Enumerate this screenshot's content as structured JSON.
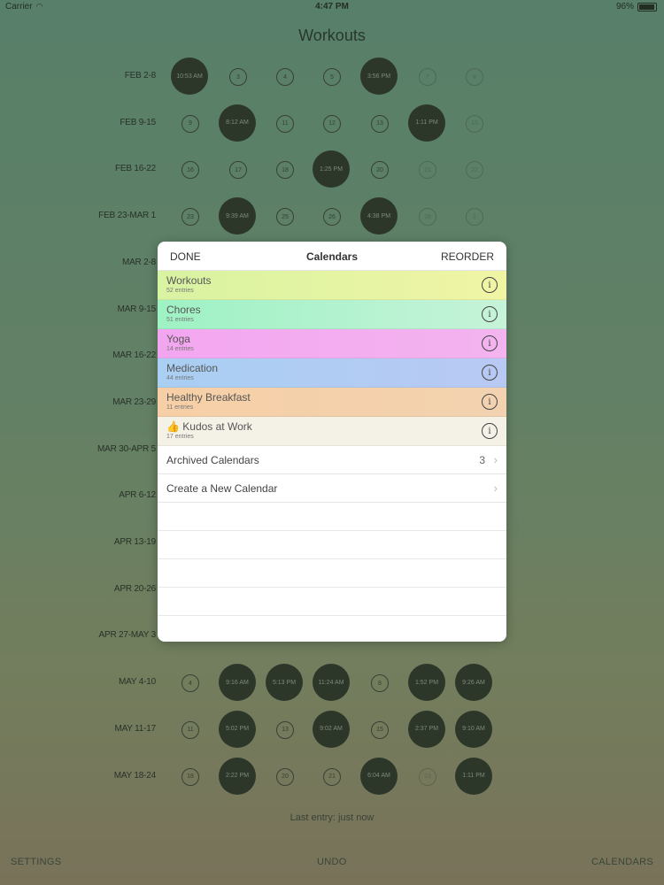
{
  "status": {
    "carrier": "Carrier",
    "time": "4:47 PM",
    "battery": "96%"
  },
  "title": "Workouts",
  "weeks": [
    {
      "label": "FEB 2-8",
      "cells": [
        {
          "t": "10:53 AM",
          "d": 1
        },
        {
          "t": "3",
          "d": 0
        },
        {
          "t": "4",
          "d": 0
        },
        {
          "t": "5",
          "d": 0
        },
        {
          "t": "3:56 PM",
          "d": 1
        },
        {
          "t": "7",
          "d": 0,
          "f": 1
        },
        {
          "t": "8",
          "d": 0,
          "f": 1
        }
      ]
    },
    {
      "label": "FEB 9-15",
      "cells": [
        {
          "t": "9",
          "d": 0
        },
        {
          "t": "8:12 AM",
          "d": 1
        },
        {
          "t": "11",
          "d": 0
        },
        {
          "t": "12",
          "d": 0
        },
        {
          "t": "13",
          "d": 0
        },
        {
          "t": "1:11 PM",
          "d": 1
        },
        {
          "t": "15",
          "d": 0,
          "f": 1
        }
      ]
    },
    {
      "label": "FEB 16-22",
      "cells": [
        {
          "t": "16",
          "d": 0
        },
        {
          "t": "17",
          "d": 0
        },
        {
          "t": "18",
          "d": 0
        },
        {
          "t": "1:25 PM",
          "d": 1
        },
        {
          "t": "20",
          "d": 0
        },
        {
          "t": "21",
          "d": 0,
          "f": 1
        },
        {
          "t": "22",
          "d": 0,
          "f": 1
        }
      ]
    },
    {
      "label": "FEB 23-MAR 1",
      "cells": [
        {
          "t": "23",
          "d": 0
        },
        {
          "t": "9:39 AM",
          "d": 1
        },
        {
          "t": "25",
          "d": 0
        },
        {
          "t": "26",
          "d": 0
        },
        {
          "t": "4:38 PM",
          "d": 1
        },
        {
          "t": "28",
          "d": 0,
          "f": 1
        },
        {
          "t": "1",
          "d": 0,
          "f": 1
        }
      ]
    },
    {
      "label": "MAR 2-8",
      "cells": []
    },
    {
      "label": "MAR 9-15",
      "cells": []
    },
    {
      "label": "MAR 16-22",
      "cells": []
    },
    {
      "label": "MAR 23-29",
      "cells": []
    },
    {
      "label": "MAR 30-APR 5",
      "cells": []
    },
    {
      "label": "APR 6-12",
      "cells": []
    },
    {
      "label": "APR 13-19",
      "cells": []
    },
    {
      "label": "APR 20-26",
      "cells": []
    },
    {
      "label": "APR 27-MAY 3",
      "cells": []
    },
    {
      "label": "MAY 4-10",
      "cells": [
        {
          "t": "4",
          "d": 0
        },
        {
          "t": "9:16 AM",
          "d": 1
        },
        {
          "t": "5:13 PM",
          "d": 1
        },
        {
          "t": "11:24 AM",
          "d": 1
        },
        {
          "t": "8",
          "d": 0
        },
        {
          "t": "1:52 PM",
          "d": 1
        },
        {
          "t": "9:26 AM",
          "d": 1
        }
      ]
    },
    {
      "label": "MAY 11-17",
      "cells": [
        {
          "t": "11",
          "d": 0
        },
        {
          "t": "5:02 PM",
          "d": 1
        },
        {
          "t": "13",
          "d": 0
        },
        {
          "t": "9:02 AM",
          "d": 1
        },
        {
          "t": "15",
          "d": 0
        },
        {
          "t": "2:37 PM",
          "d": 1
        },
        {
          "t": "9:10 AM",
          "d": 1
        }
      ]
    },
    {
      "label": "MAY 18-24",
      "cells": [
        {
          "t": "18",
          "d": 0
        },
        {
          "t": "2:22 PM",
          "d": 1
        },
        {
          "t": "20",
          "d": 0
        },
        {
          "t": "21",
          "d": 0
        },
        {
          "t": "6:04 AM",
          "d": 1
        },
        {
          "t": "23",
          "d": 0,
          "f": 1
        },
        {
          "t": "1:11 PM",
          "d": 1
        }
      ]
    }
  ],
  "last_entry": "Last entry: just now",
  "bottom": {
    "settings": "SETTINGS",
    "undo": "UNDO",
    "calendars": "CALENDARS"
  },
  "popover": {
    "done": "DONE",
    "title": "Calendars",
    "reorder": "REORDER",
    "calendars": [
      {
        "name": "Workouts",
        "count": "52 entries",
        "color": "linear-gradient(90deg,#d8f3a2,#f0f5a4)"
      },
      {
        "name": "Chores",
        "count": "51 entries",
        "color": "linear-gradient(90deg,#9ef2c4,#c6f3d9)"
      },
      {
        "name": "Yoga",
        "count": "14 entries",
        "color": "linear-gradient(90deg,#f3a6f0,#f3b4ef)"
      },
      {
        "name": "Medication",
        "count": "44 entries",
        "color": "linear-gradient(90deg,#a9cff2,#b8c9f3)"
      },
      {
        "name": "Healthy Breakfast",
        "count": "11 entries",
        "color": "linear-gradient(90deg,#f6cfa6,#f2d2b0)"
      },
      {
        "name": "👍 Kudos at Work",
        "count": "17 entries",
        "color": "#f4f1e7"
      }
    ],
    "archived_label": "Archived Calendars",
    "archived_count": "3",
    "create_label": "Create a New Calendar"
  }
}
